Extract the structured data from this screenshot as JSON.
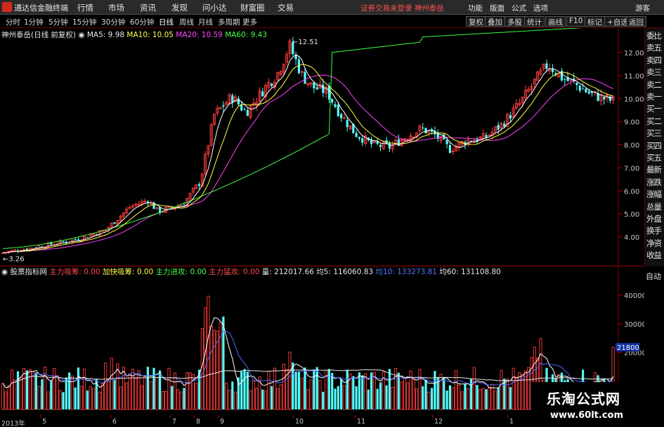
{
  "app": {
    "title": "通达信金融终端"
  },
  "menu": [
    "行情",
    "市场",
    "资讯",
    "发现",
    "问小达",
    "财富圈",
    "交易"
  ],
  "status": {
    "text": "证券交易未登录  神州泰岳"
  },
  "menu_right": [
    "功能",
    "版面",
    "公式",
    "选项"
  ],
  "guest": "游客",
  "periods": [
    "分时",
    "1分钟",
    "5分钟",
    "15分钟",
    "30分钟",
    "60分钟",
    "日线",
    "周线",
    "月线",
    "多周期",
    "更多"
  ],
  "toolbar": [
    "复权",
    "叠加",
    "多股",
    "统计",
    "画线",
    "F10",
    "标记",
    "+自选",
    "返回"
  ],
  "main_panel": {
    "stock_label": "神州泰岳(日线 前复权)",
    "ma5": "MA5: 9.98",
    "ma10": "MA10: 10.05",
    "ma20": "MA20: 10.59",
    "ma60": "MA60: 9.43",
    "high_label": "12.51",
    "low_label": "3.26",
    "y_ticks": [
      "12.00",
      "11.00",
      "10.00",
      "9.00",
      "8.00",
      "7.00",
      "6.00",
      "5.00",
      "4.00"
    ]
  },
  "indicator_panel": {
    "name": "股票指标网",
    "items": [
      {
        "label": "主力吸筹: 0.00",
        "color": "red"
      },
      {
        "label": "加快吸筹: 0.00",
        "color": "yellow"
      },
      {
        "label": "主力进攻: 0.00",
        "color": "green"
      },
      {
        "label": "主力猛攻: 0.00",
        "color": "red"
      }
    ],
    "vol": "量: 212017.66",
    "vol5": "均5: 116060.83",
    "vol10": "均10: 133273.81",
    "vol60": "均60: 131108.80",
    "y_ticks": [
      "40000",
      "30000",
      "20000"
    ],
    "current_vol": "21800"
  },
  "side_panel": [
    "委比",
    "卖五",
    "卖四",
    "卖三",
    "卖二",
    "卖一",
    "买一",
    "买二",
    "买三",
    "买四",
    "买五",
    "最新",
    "涨跌",
    "涨幅",
    "总量",
    "外盘",
    "换手",
    "净资",
    "收益"
  ],
  "auto_label": "自动",
  "x_axis": [
    {
      "label": "2013年",
      "x": 2
    },
    {
      "label": "5",
      "x": 60
    },
    {
      "label": "6",
      "x": 160
    },
    {
      "label": "7",
      "x": 245
    },
    {
      "label": "8",
      "x": 279
    },
    {
      "label": "9",
      "x": 313
    },
    {
      "label": "10",
      "x": 420
    },
    {
      "label": "11",
      "x": 508
    },
    {
      "label": "12",
      "x": 618
    },
    {
      "label": "1",
      "x": 725
    }
  ],
  "watermark": {
    "line1": "乐淘公式网",
    "line2": "www.60lt.com"
  },
  "colors": {
    "up": "#ff3c3c",
    "down": "#54ffff",
    "ma5": "#ffffff",
    "ma10": "#ffff40",
    "ma20": "#ff40ff",
    "ma60": "#40ff40"
  }
}
